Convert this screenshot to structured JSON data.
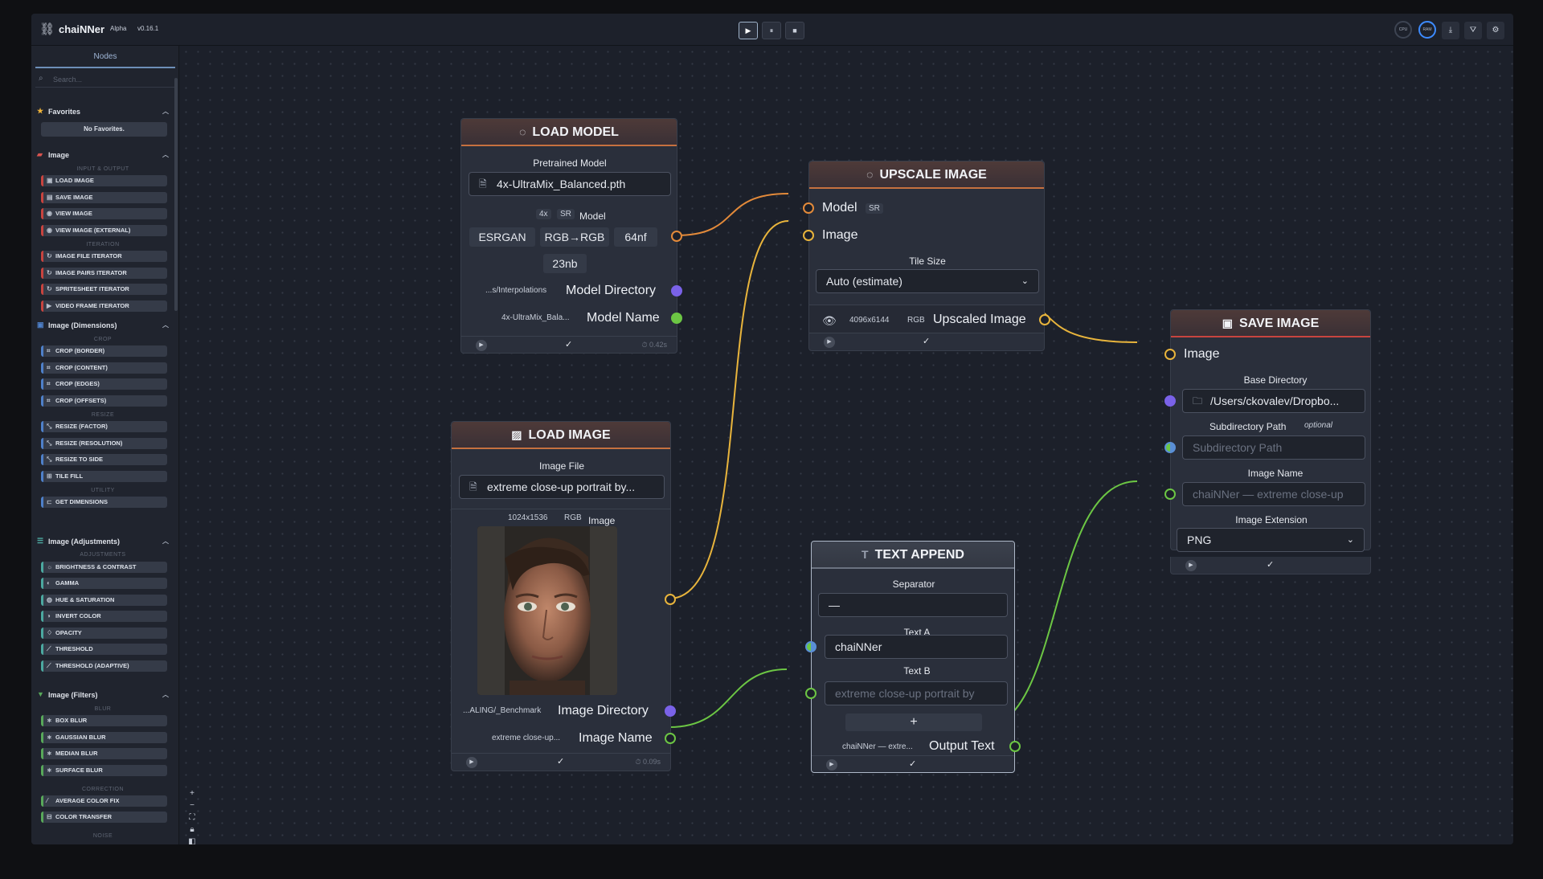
{
  "header": {
    "app_name": "chaiNNer",
    "badge": "Alpha",
    "version": "v0.16.1",
    "controls": {
      "run": "▶",
      "pause": "⏸",
      "stop": "■"
    },
    "gauges": {
      "cpu": "CPU",
      "ram": "RAM"
    },
    "icons": [
      "download-icon",
      "camera-icon",
      "gear-icon"
    ]
  },
  "sidebar": {
    "tab": "Nodes",
    "search_placeholder": "Search...",
    "favorites": {
      "label": "Favorites",
      "empty": "No Favorites."
    },
    "categories": {
      "image": {
        "label": "Image",
        "sub_io": "INPUT & OUTPUT",
        "sub_iter": "ITERATION"
      },
      "dimensions": {
        "label": "Image (Dimensions)",
        "sub_crop": "CROP",
        "sub_resize": "RESIZE",
        "sub_utility": "UTILITY"
      },
      "adjustments": {
        "label": "Image (Adjustments)",
        "sub_adj": "ADJUSTMENTS"
      },
      "filters": {
        "label": "Image (Filters)",
        "sub_blur": "BLUR",
        "sub_correction": "CORRECTION",
        "sub_noise": "NOISE"
      }
    },
    "items": [
      "LOAD IMAGE",
      "SAVE IMAGE",
      "VIEW IMAGE",
      "VIEW IMAGE (EXTERNAL)",
      "IMAGE FILE ITERATOR",
      "IMAGE PAIRS ITERATOR",
      "SPRITESHEET ITERATOR",
      "VIDEO FRAME ITERATOR",
      "CROP (BORDER)",
      "CROP (CONTENT)",
      "CROP (EDGES)",
      "CROP (OFFSETS)",
      "RESIZE (FACTOR)",
      "RESIZE (RESOLUTION)",
      "RESIZE TO SIDE",
      "TILE FILL",
      "GET DIMENSIONS",
      "BRIGHTNESS & CONTRAST",
      "GAMMA",
      "HUE & SATURATION",
      "INVERT COLOR",
      "OPACITY",
      "THRESHOLD",
      "THRESHOLD (ADAPTIVE)",
      "BOX BLUR",
      "GAUSSIAN BLUR",
      "MEDIAN BLUR",
      "SURFACE BLUR",
      "AVERAGE COLOR FIX",
      "COLOR TRANSFER"
    ]
  },
  "nodes": {
    "load_model": {
      "title": "LOAD MODEL",
      "input_label": "Pretrained Model",
      "file": "4x-UltraMix_Balanced.pth",
      "tags": [
        "4x",
        "SR"
      ],
      "model_label": "Model",
      "chips": [
        "ESRGAN",
        "RGB→RGB",
        "64nf",
        "23nb"
      ],
      "dir_value": "...s/Interpolations",
      "dir_label": "Model Directory",
      "name_value": "4x-UltraMix_Bala...",
      "name_label": "Model Name",
      "time": "⏱ 0.42s"
    },
    "upscale": {
      "title": "UPSCALE IMAGE",
      "model_label": "Model",
      "model_tag": "SR",
      "image_label": "Image",
      "tile_label": "Tile Size",
      "tile_value": "Auto (estimate)",
      "out_size": "4096x6144",
      "out_tag": "RGB",
      "out_label": "Upscaled Image"
    },
    "load_image": {
      "title": "LOAD IMAGE",
      "input_label": "Image File",
      "file": "extreme close-up portrait by...",
      "size": "1024x1536",
      "tag": "RGB",
      "image_label": "Image",
      "dir_value": "...ALING/_Benchmark",
      "dir_label": "Image Directory",
      "name_value": "extreme close-up...",
      "name_label": "Image Name",
      "time": "⏱ 0.09s"
    },
    "text_append": {
      "title": "TEXT APPEND",
      "sep_label": "Separator",
      "sep_value": "—",
      "a_label": "Text A",
      "a_value": "chaiNNer",
      "b_label": "Text B",
      "b_placeholder": "extreme close-up portrait by",
      "plus": "+",
      "out_value": "chaiNNer — extre...",
      "out_label": "Output Text"
    },
    "save_image": {
      "title": "SAVE IMAGE",
      "image_label": "Image",
      "base_label": "Base Directory",
      "base_value": "/Users/ckovalev/Dropbo...",
      "sub_label": "Subdirectory Path",
      "sub_optional": "optional",
      "sub_placeholder": "Subdirectory Path",
      "name_label": "Image Name",
      "name_placeholder": "chaiNNer — extreme close-up",
      "ext_label": "Image Extension",
      "ext_value": "PNG"
    }
  },
  "colors": {
    "model_edge": "#e38a3a",
    "image_edge": "#e8b43c",
    "text_edge": "#6cc644",
    "dir_handle": "#7a62e8"
  }
}
